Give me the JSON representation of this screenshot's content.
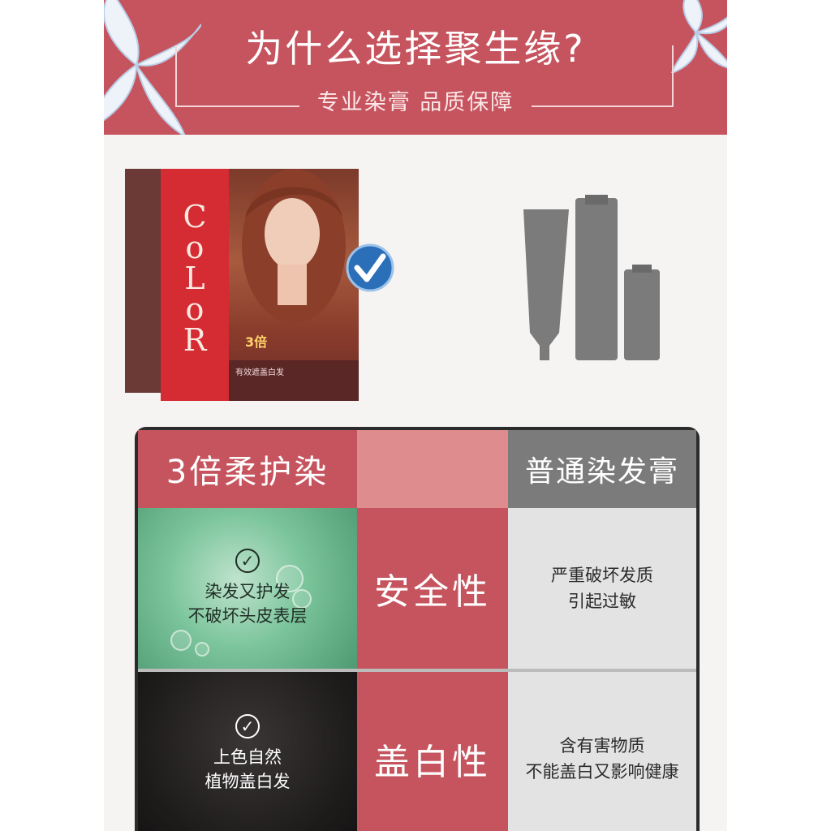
{
  "header": {
    "title": "为什么选择聚生缘?",
    "subtitle": "专业染膏 品质保障"
  },
  "product": {
    "box_brand": [
      "C",
      "o",
      "L",
      "o",
      "R"
    ],
    "box_badge": "3倍",
    "box_band_text": "有效遮盖白发"
  },
  "table": {
    "header_left": "3倍柔护染",
    "header_right": "普通染发膏",
    "rows": [
      {
        "feature_lines": [
          "染发又护发",
          "不破坏头皮表层"
        ],
        "category": "安全性",
        "ordinary_lines": [
          "严重破坏发质",
          "引起过敏"
        ]
      },
      {
        "feature_lines": [
          "上色自然",
          "植物盖白发"
        ],
        "category": "盖白性",
        "ordinary_lines": [
          "含有害物质",
          "不能盖白又影响健康"
        ]
      }
    ]
  },
  "colors": {
    "accent": "#c6545e",
    "accent_light": "#de8c8e",
    "gray": "#7b7b7b",
    "panel": "#e3e3e3"
  }
}
